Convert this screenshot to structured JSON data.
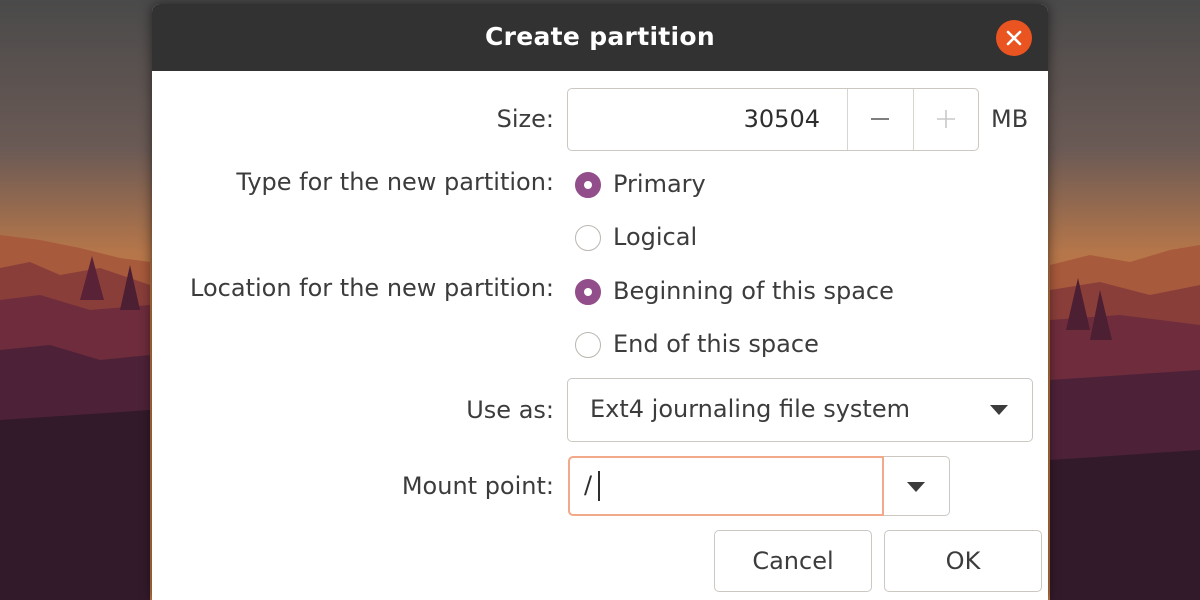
{
  "dialog": {
    "title": "Create partition"
  },
  "size": {
    "label": "Size:",
    "value": "30504",
    "unit": "MB"
  },
  "type": {
    "label": "Type for the new partition:",
    "options": [
      "Primary",
      "Logical"
    ],
    "selected": "Primary"
  },
  "location": {
    "label": "Location for the new partition:",
    "options": [
      "Beginning of this space",
      "End of this space"
    ],
    "selected": "Beginning of this space"
  },
  "use_as": {
    "label": "Use as:",
    "value": "Ext4 journaling file system"
  },
  "mount_point": {
    "label": "Mount point:",
    "value": "/"
  },
  "buttons": {
    "cancel": "Cancel",
    "ok": "OK"
  },
  "colors": {
    "accent": "#924d8b",
    "close": "#e95420",
    "focus_border": "#f2a98a",
    "titlebar": "#323232"
  },
  "icons": {
    "close": "close-icon",
    "minus": "minus-icon",
    "plus": "plus-icon",
    "dropdown": "triangle-down-icon"
  }
}
